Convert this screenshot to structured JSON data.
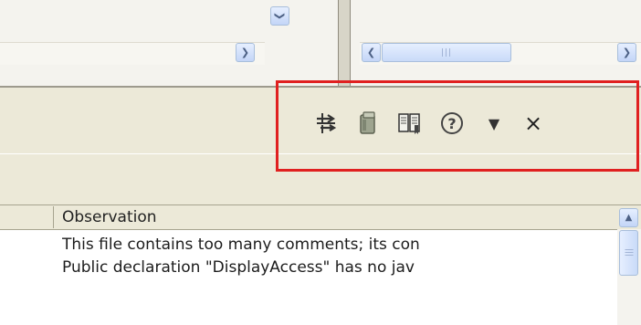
{
  "colors": {
    "highlight": "#e02020",
    "background": "#ece9d8",
    "scroll_button": "#c3d5f7"
  },
  "scrollbars": {
    "top_down_arrow": "❯",
    "left_arrow": "❮",
    "right_arrow": "❯",
    "up_arrow": "▲",
    "grip": "|||"
  },
  "view_toolbar": {
    "icons": [
      "pin-icon",
      "clipboard-icon",
      "book-icon",
      "help-icon",
      "menu-dropdown-icon",
      "close-icon"
    ],
    "help_glyph": "?",
    "close_glyph": "×",
    "menu_glyph": "▼"
  },
  "table": {
    "columns": [
      "Observation"
    ],
    "rows": [
      "This file contains too many comments; its con",
      "Public declaration \"DisplayAccess\" has no jav"
    ]
  }
}
